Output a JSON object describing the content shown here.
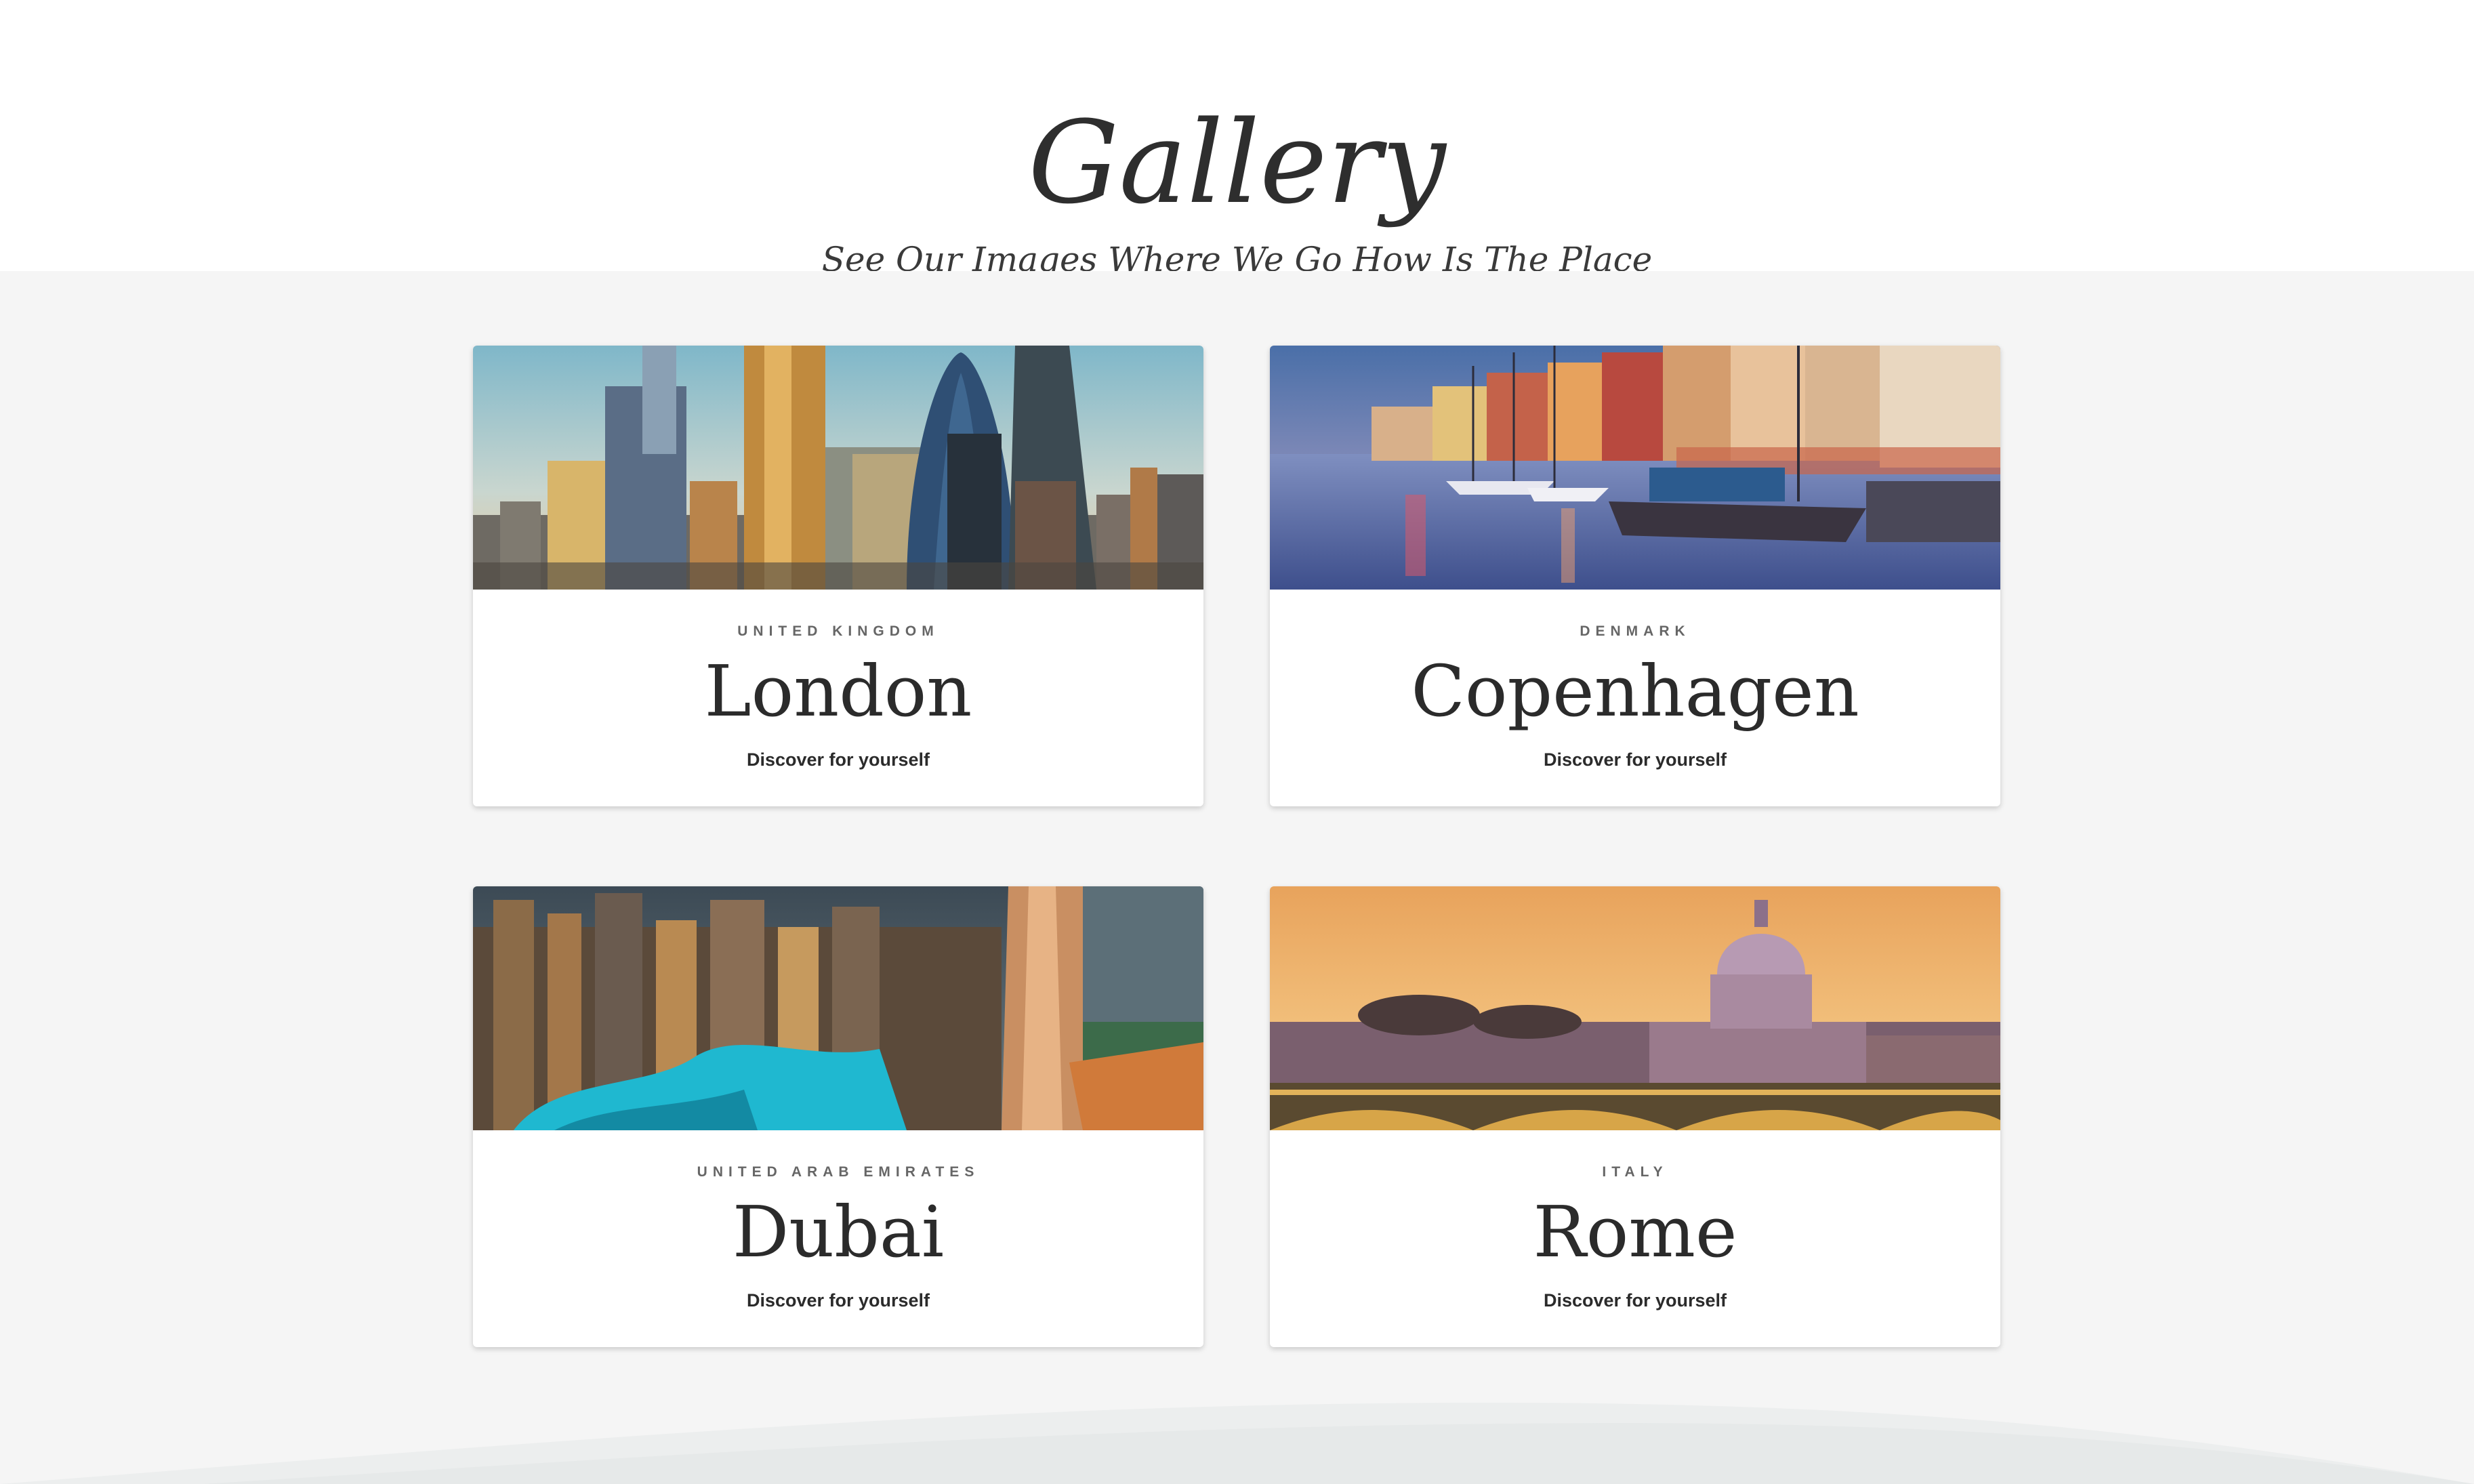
{
  "header": {
    "title": "Gallery",
    "subtitle": "See Our Images Where We Go How Is The Place"
  },
  "cards": [
    {
      "country": "UNITED KINGDOM",
      "city": "London",
      "cta": "Discover for yourself"
    },
    {
      "country": "DENMARK",
      "city": "Copenhagen",
      "cta": "Discover for yourself"
    },
    {
      "country": "UNITED ARAB EMIRATES",
      "city": "Dubai",
      "cta": "Discover for yourself"
    },
    {
      "country": "ITALY",
      "city": "Rome",
      "cta": "Discover for yourself"
    }
  ],
  "colors": {
    "page_background": "#ffffff",
    "gallery_background": "#f5f5f5",
    "card_background": "#ffffff",
    "text_dark": "#2b2b2b",
    "text_muted": "#666666"
  }
}
